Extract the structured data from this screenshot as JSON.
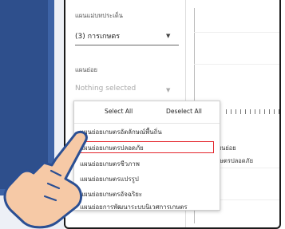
{
  "filters": {
    "plan_label": "แผนแม่บทประเด็น",
    "plan_value": "(3) การเกษตร",
    "subplan_label": "แผนย่อย",
    "subplan_placeholder": "Nothing selected"
  },
  "dropdown": {
    "select_all": "Select All",
    "deselect_all": "Deselect All",
    "options": [
      "แผนย่อยเกษตรอัตลักษณ์พื้นถิ่น",
      "แผนย่อยเกษตรปลอดภัย",
      "แผนย่อยเกษตรชีวภาพ",
      "แผนย่อยเกษตรแปรรูป",
      "แผนย่อยเกษตรอัจฉริยะ",
      "แผนย่อยการพัฒนาระบบนิเวศการเกษตร"
    ],
    "highlighted_index": 1
  },
  "chart_side": {
    "label_1": "แผนย่อย",
    "label_2": "เกษตรปลอดภัย"
  },
  "colors": {
    "highlight": "#e3262c",
    "hand_fill": "#f6c9a6",
    "hand_outline": "#2b4f93",
    "panel_blue": "#2e4f8c"
  },
  "icons": {
    "caret": "caret-down-icon",
    "pointer": "pointing-hand-icon"
  }
}
